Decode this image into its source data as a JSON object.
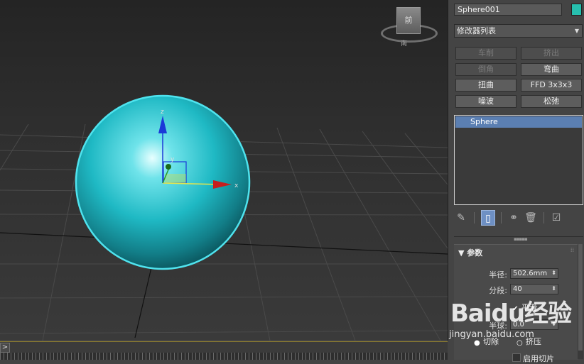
{
  "viewport": {
    "viewcube_face": "前",
    "viewcube_compass": "南",
    "gizmo_z_label": "z",
    "gizmo_x_label": "x",
    "gizmo_y_label": "y"
  },
  "timebar": {
    "expand_label": ">"
  },
  "panel": {
    "object_name": "Sphere001",
    "object_color": "#27bfae",
    "modifier_list_label": "修改器列表",
    "modifier_buttons": [
      {
        "label": "车削",
        "enabled": false
      },
      {
        "label": "挤出",
        "enabled": false
      },
      {
        "label": "倒角",
        "enabled": false
      },
      {
        "label": "弯曲",
        "enabled": true
      },
      {
        "label": "扭曲",
        "enabled": true
      },
      {
        "label": "FFD 3x3x3",
        "enabled": true
      },
      {
        "label": "噪波",
        "enabled": true
      },
      {
        "label": "松弛",
        "enabled": true
      }
    ],
    "stack_items": [
      "Sphere"
    ],
    "tools": [
      "pin-stack-icon",
      "show-end-result-icon",
      "make-unique-icon",
      "remove-modifier-icon",
      "configure-sets-icon"
    ],
    "rollout": {
      "title": "参数",
      "radius_label": "半径:",
      "radius_value": "502.6mm",
      "segments_label": "分段:",
      "segments_value": "40",
      "smooth_label": "平滑",
      "hemisphere_label": "半球:",
      "hemisphere_value": "0.0",
      "chop_label": "切除",
      "squash_label": "挤压",
      "enable_slice_label": "启用切片"
    }
  },
  "watermark": {
    "logo_text": "Baidu经验",
    "url_text": "jingyan.baidu.com"
  },
  "colors": {
    "sphere_fill": "#1fb9c4",
    "selection_outline": "#4fe3ee",
    "stack_selected": "#5b7fb2",
    "axis_x": "#c81e1e",
    "axis_y": "#2a9a2a",
    "axis_z": "#1a3ad8"
  }
}
